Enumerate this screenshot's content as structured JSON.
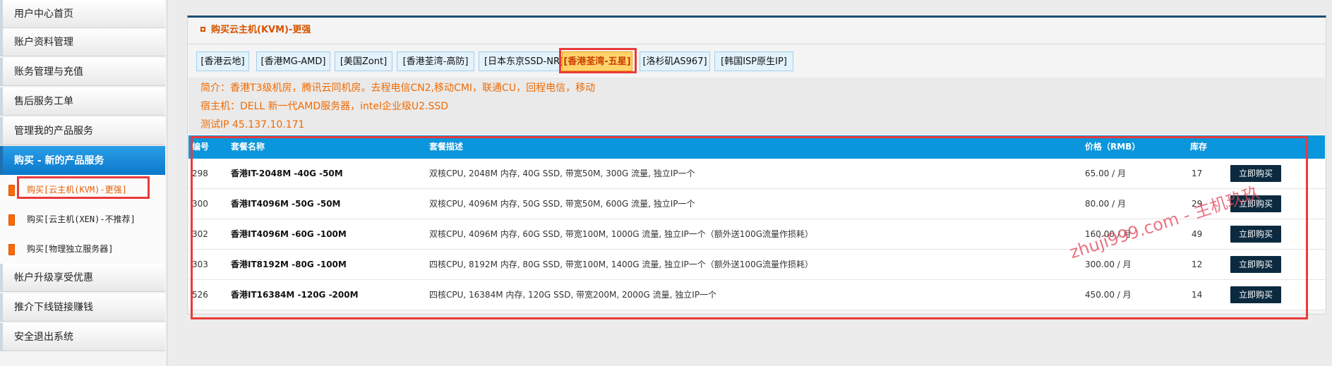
{
  "sidebar": {
    "items": [
      {
        "label": "用户中心首页"
      },
      {
        "label": "账户资料管理"
      },
      {
        "label": "账务管理与充值"
      },
      {
        "label": "售后服务工单"
      },
      {
        "label": "管理我的产品服务"
      },
      {
        "label": "购买 - 新的产品服务"
      },
      {
        "label": "帐户升级享受优惠"
      },
      {
        "label": "推介下线链接赚钱"
      },
      {
        "label": "安全退出系统"
      }
    ],
    "sub_items": [
      {
        "label": "购买[云主机(KVM)-更强]"
      },
      {
        "label": "购买[云主机(XEN)-不推荐]"
      },
      {
        "label": "购买[物理独立服务器]"
      }
    ]
  },
  "main": {
    "title": "购买云主机(KVM)-更强",
    "tabs": [
      {
        "label": "[香港云地]"
      },
      {
        "label": "[香港MG-AMD]"
      },
      {
        "label": "[美国Zont]"
      },
      {
        "label": "[香港荃湾-高防]"
      },
      {
        "label": "[日本东京SSD-NR]"
      },
      {
        "label": "[香港荃湾-五星]"
      },
      {
        "label": "[洛杉矶AS967]"
      },
      {
        "label": "[韩国ISP原生IP]"
      }
    ],
    "intro": {
      "line1": "简介：香港T3级机房，腾讯云同机房。去程电信CN2,移动CMI，联通CU，回程电信，移动",
      "line2": "宿主机：DELL 新一代AMD服务器，intel企业级U2.SSD",
      "line3": "测试IP 45.137.10.171"
    },
    "table": {
      "headers": {
        "id": "编号",
        "name": "套餐名称",
        "desc": "套餐描述",
        "price": "价格（RMB）",
        "stock": "库存"
      },
      "rows": [
        {
          "id": "298",
          "name": "香港IT-2048M -40G -50M",
          "desc": "双核CPU, 2048M 内存, 40G SSD, 带宽50M, 300G 流量, 独立IP一个",
          "price": "65.00 / 月",
          "stock": "17",
          "button": "立即购买"
        },
        {
          "id": "300",
          "name": "香港IT4096M -50G -50M",
          "desc": "双核CPU, 4096M 内存, 50G SSD, 带宽50M, 600G 流量, 独立IP一个",
          "price": "80.00 / 月",
          "stock": "29",
          "button": "立即购买"
        },
        {
          "id": "302",
          "name": "香港IT4096M -60G -100M",
          "desc": "双核CPU, 4096M 内存, 60G SSD, 带宽100M, 1000G 流量, 独立IP一个（额外送100G流量作损耗）",
          "price": "160.00 / 月",
          "stock": "49",
          "button": "立即购买"
        },
        {
          "id": "303",
          "name": "香港IT8192M -80G -100M",
          "desc": "四核CPU, 8192M 内存, 80G SSD, 带宽100M, 1400G 流量, 独立IP一个（额外送100G流量作损耗）",
          "price": "300.00 / 月",
          "stock": "12",
          "button": "立即购买"
        },
        {
          "id": "526",
          "name": "香港IT16384M -120G -200M",
          "desc": "四核CPU, 16384M 内存, 120G SSD, 带宽200M, 2000G 流量, 独立IP一个",
          "price": "450.00 / 月",
          "stock": "14",
          "button": "立即购买"
        }
      ]
    }
  },
  "watermark": "zhuji999.com - 主机玖玖",
  "colors": {
    "accent_blue": "#0a96dc",
    "orange_text": "#f06a00",
    "highlight_red": "#ea3a3a",
    "buy_button": "#0c2a3f"
  }
}
